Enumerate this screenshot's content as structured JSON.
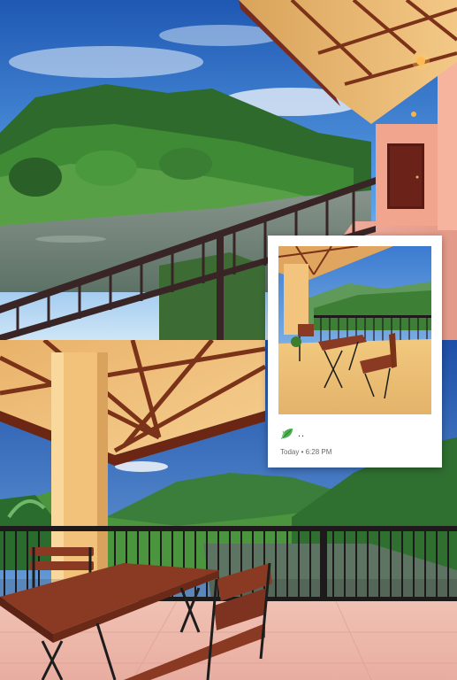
{
  "story": {
    "caption": "..",
    "timestamp": "Today • 6:28 PM",
    "sticker_icon": "leaf-icon"
  },
  "scenes": [
    {
      "name": "top",
      "description_id": "balcony-river-view"
    },
    {
      "name": "bottom",
      "description_id": "balcony-table-chairs"
    }
  ],
  "colors": {
    "sky": "#2f6fc2",
    "forest": "#2f6a2a",
    "river": "#6d7f74",
    "railing": "#3a2526",
    "wall": "#f1a58f",
    "wood": "#8a3a22",
    "pillar": "#f3c27a"
  }
}
